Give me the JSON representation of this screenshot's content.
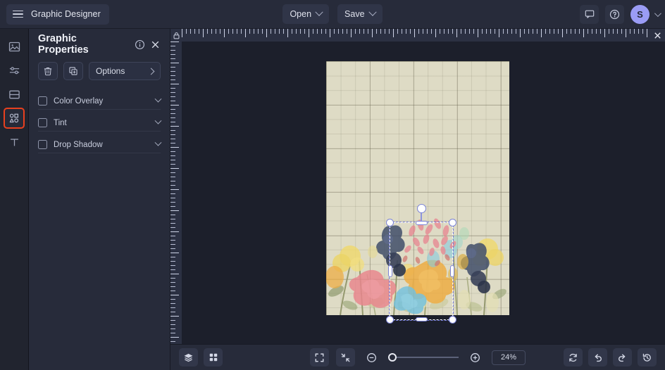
{
  "topbar": {
    "menu_icon": "hamburger-icon",
    "app_title": "Graphic Designer",
    "open_label": "Open",
    "save_label": "Save",
    "comment_icon": "comment-icon",
    "help_icon": "help-circle-icon",
    "avatar_initial": "S"
  },
  "rail": {
    "items": [
      {
        "name": "image-tool",
        "icon": "image-icon",
        "active": false
      },
      {
        "name": "adjust-tool",
        "icon": "sliders-icon",
        "active": false
      },
      {
        "name": "layout-tool",
        "icon": "layout-icon",
        "active": false
      },
      {
        "name": "shapes-tool",
        "icon": "shapes-icon",
        "active": true
      },
      {
        "name": "text-tool",
        "icon": "text-t-icon",
        "active": false
      }
    ],
    "active_color": "#e8401f"
  },
  "panel": {
    "title": "Graphic Properties",
    "info_icon": "info-circle-icon",
    "close_icon": "close-x-icon",
    "delete_icon": "trash-icon",
    "duplicate_icon": "duplicate-icon",
    "options_label": "Options",
    "effects": [
      {
        "label": "Color Overlay",
        "checked": false
      },
      {
        "label": "Tint",
        "checked": false
      },
      {
        "label": "Drop Shadow",
        "checked": false
      }
    ]
  },
  "stage": {
    "lock_icon": "lock-icon",
    "ruler_close_icon": "close-x-icon",
    "canvas_bg_color": "#dedbc5",
    "selection": {
      "visible": true,
      "handles": 4,
      "rotation_handle": true
    }
  },
  "bottombar": {
    "layers_icon": "layers-icon",
    "grid_icon": "grid-icon",
    "fullscreen_icon": "fullscreen-icon",
    "fit_icon": "fit-to-screen-icon",
    "zoom_out_icon": "zoom-out-icon",
    "zoom_in_icon": "zoom-in-icon",
    "zoom_value": "24%",
    "zoom_percent": 24,
    "refresh_icon": "refresh-icon",
    "undo_icon": "undo-icon",
    "redo_icon": "redo-icon",
    "history_icon": "history-icon"
  }
}
